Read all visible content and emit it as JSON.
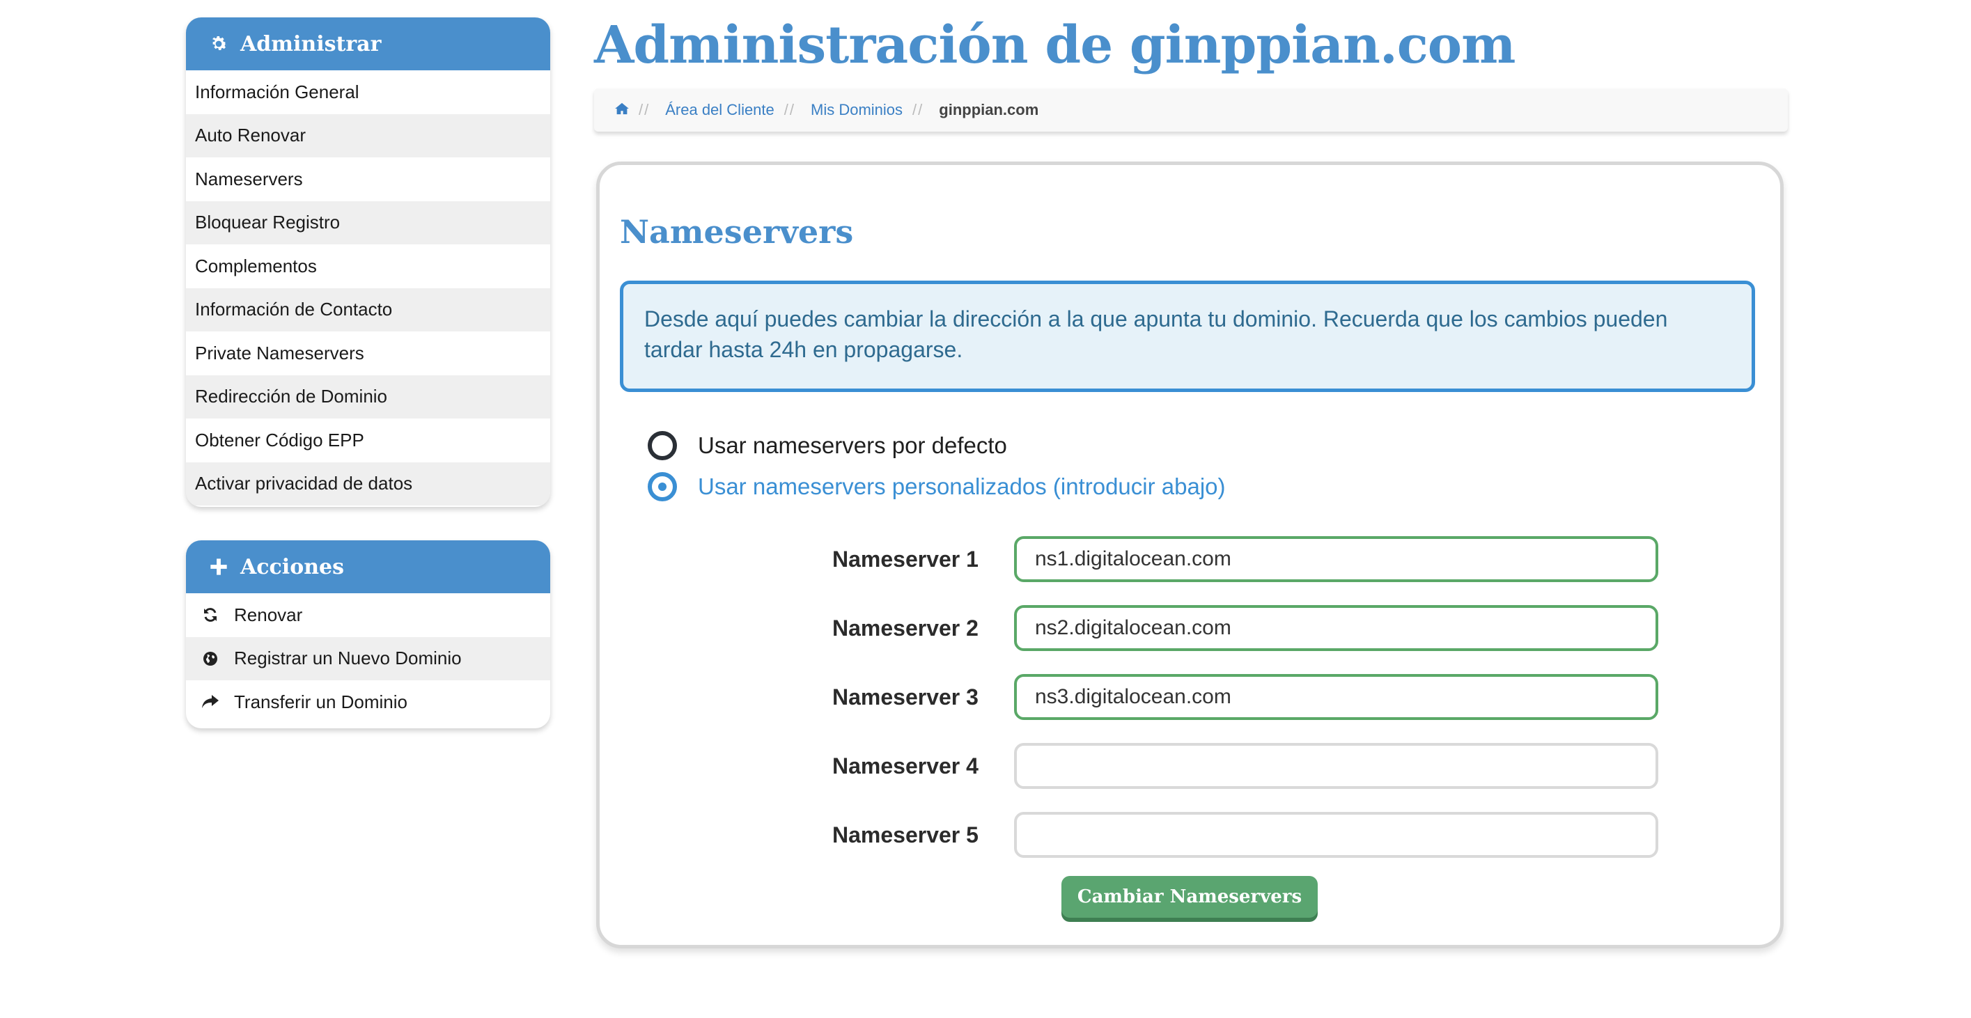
{
  "page": {
    "title": "Administración de ginppian.com"
  },
  "breadcrumb": {
    "items": [
      {
        "label": "Área del Cliente"
      },
      {
        "label": "Mis Dominios"
      }
    ],
    "current": "ginppian.com",
    "separator": "//"
  },
  "sidebar": {
    "admin": {
      "title": "Administrar",
      "icon": "gear-icon",
      "items": [
        {
          "label": "Información General"
        },
        {
          "label": "Auto Renovar"
        },
        {
          "label": "Nameservers"
        },
        {
          "label": "Bloquear Registro"
        },
        {
          "label": "Complementos"
        },
        {
          "label": "Información de Contacto"
        },
        {
          "label": "Private Nameservers"
        },
        {
          "label": "Redirección de Dominio"
        },
        {
          "label": "Obtener Código EPP"
        },
        {
          "label": "Activar privacidad de datos"
        }
      ]
    },
    "actions": {
      "title": "Acciones",
      "icon": "plus-icon",
      "items": [
        {
          "label": "Renovar",
          "icon": "refresh-icon"
        },
        {
          "label": "Registrar un Nuevo Dominio",
          "icon": "globe-icon"
        },
        {
          "label": "Transferir un Dominio",
          "icon": "share-arrow-icon"
        }
      ]
    }
  },
  "main": {
    "section_title": "Nameservers",
    "info": "Desde aquí puedes cambiar la dirección a la que apunta tu dominio. Recuerda que los cambios pueden tardar hasta 24h en propagarse.",
    "options": [
      {
        "label": "Usar nameservers por defecto",
        "selected": false
      },
      {
        "label": "Usar nameservers personalizados (introducir abajo)",
        "selected": true
      }
    ],
    "nameservers": [
      {
        "label": "Nameserver 1",
        "value": "ns1.digitalocean.com"
      },
      {
        "label": "Nameserver 2",
        "value": "ns2.digitalocean.com"
      },
      {
        "label": "Nameserver 3",
        "value": "ns3.digitalocean.com"
      },
      {
        "label": "Nameserver 4",
        "value": ""
      },
      {
        "label": "Nameserver 5",
        "value": ""
      }
    ],
    "submit_label": "Cambiar Nameservers"
  },
  "colors": {
    "brand_blue": "#4a8fcc",
    "success_green": "#5aa570",
    "info_bg": "#e6f2f9"
  }
}
